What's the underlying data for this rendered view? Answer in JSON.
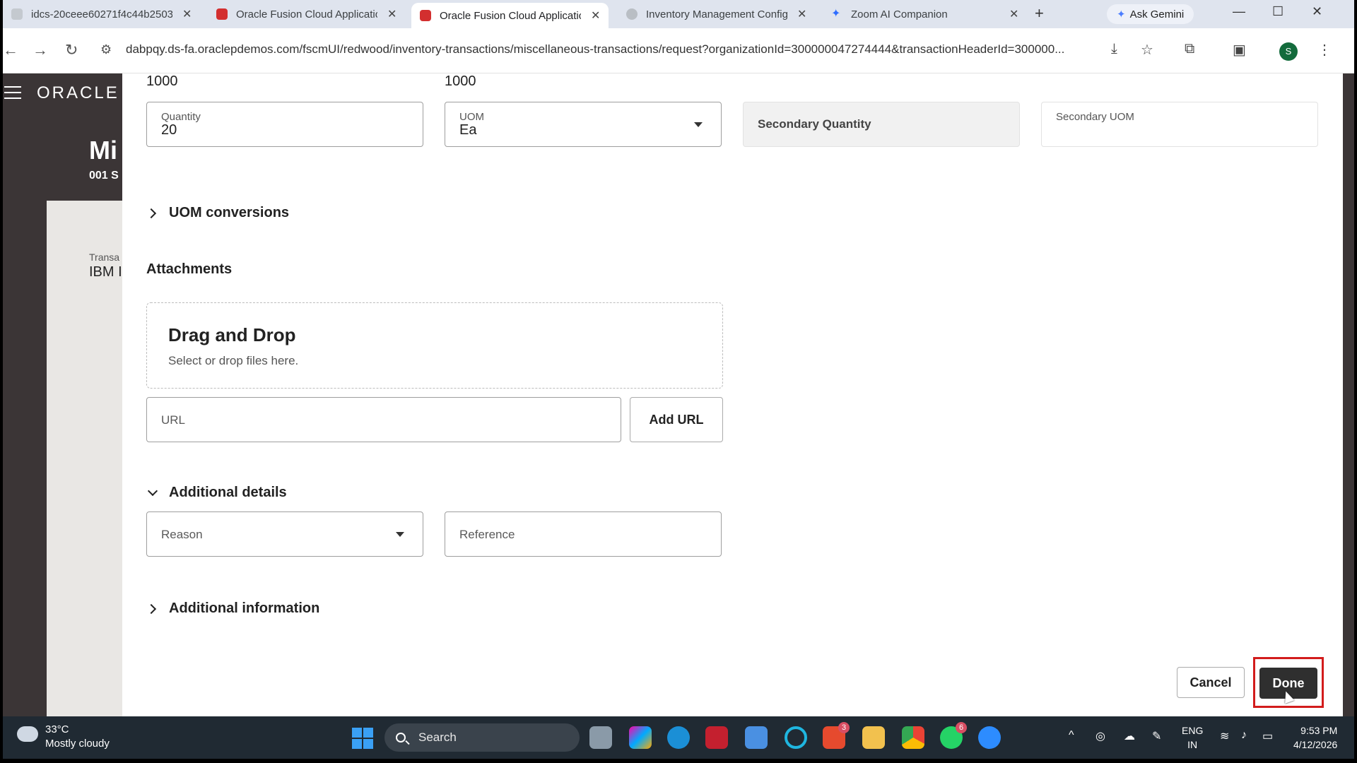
{
  "browser": {
    "tabs": [
      {
        "label": "idcs-20ceee60271f4c44b2503",
        "icon": "cloud-tab-icon",
        "color": "#9aa0a6",
        "active": false
      },
      {
        "label": "Oracle Fusion Cloud Applicatio",
        "icon": "oracle-tab-icon",
        "color": "#d32f2f",
        "active": false
      },
      {
        "label": "Oracle Fusion Cloud Applicatio",
        "icon": "oracle-tab-icon",
        "color": "#d32f2f",
        "active": true
      },
      {
        "label": "Inventory Management Config",
        "icon": "globe-tab-icon",
        "color": "#9aa0a6",
        "active": false
      },
      {
        "label": "Zoom AI Companion",
        "icon": "sparkle-tab-icon",
        "color": "#2d6cff",
        "active": false
      }
    ],
    "ask_gemini": "Ask Gemini",
    "url": "dabpqy.ds-fa.oraclepdemos.com/fscmUI/redwood/inventory-transactions/miscellaneous-transactions/request?organizationId=300000047274444&transactionHeaderId=300000...",
    "profile_initial": "S"
  },
  "app": {
    "logo": "ORACLE",
    "title_partial": "Mi",
    "subtitle_partial": "001 S",
    "trans_label_partial": "Transa",
    "trans_value_partial": "IBM I"
  },
  "drawer": {
    "top_values": [
      "1000",
      "1000"
    ],
    "quantity": {
      "label": "Quantity",
      "value": "20"
    },
    "uom": {
      "label": "UOM",
      "value": "Ea"
    },
    "secondary_quantity": {
      "label": "Secondary Quantity"
    },
    "secondary_uom": {
      "label": "Secondary UOM"
    },
    "uom_conversions": "UOM conversions",
    "attachments": {
      "title": "Attachments",
      "drop_title": "Drag and Drop",
      "drop_sub": "Select or drop files here.",
      "url_placeholder": "URL",
      "add_url": "Add URL"
    },
    "additional_details": {
      "title": "Additional details",
      "reason_placeholder": "Reason",
      "reference_placeholder": "Reference"
    },
    "additional_information": "Additional information",
    "cancel": "Cancel",
    "done": "Done"
  },
  "taskbar": {
    "temp": "33°C",
    "condition": "Mostly cloudy",
    "search": "Search",
    "lang_top": "ENG",
    "lang_bottom": "IN",
    "time": "9:53 PM",
    "date": "4/12/2026",
    "badges": {
      "teams": "3",
      "whatsapp": "6"
    }
  },
  "colors": {
    "accent_done": "#2f2f2f",
    "highlight": "#d21c1c",
    "app_bg": "#3b3536"
  }
}
